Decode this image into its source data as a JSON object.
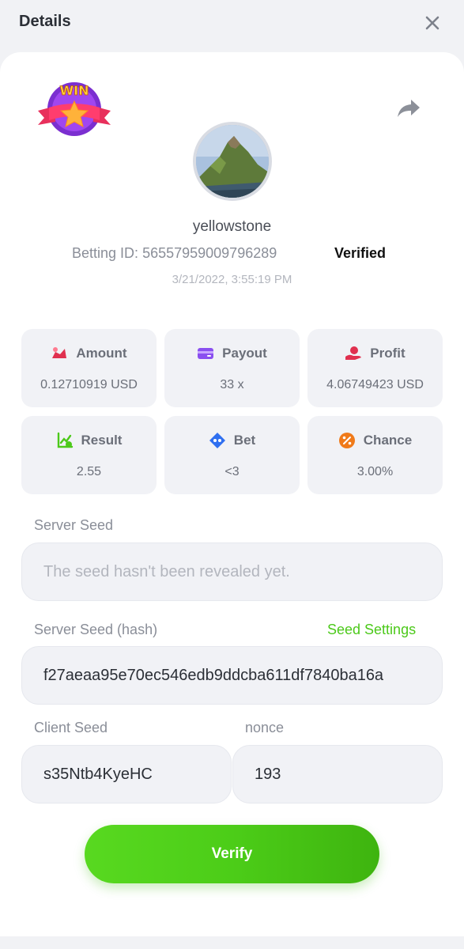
{
  "header": {
    "title": "Details"
  },
  "profile": {
    "username": "yellowstone",
    "betting_id_label": "Betting ID:",
    "betting_id": "56557959009796289",
    "verified_label": "Verified",
    "timestamp": "3/21/2022, 3:55:19 PM",
    "badge_text": "WIN"
  },
  "stats": [
    {
      "label": "Amount",
      "value": "0.12710919 USD",
      "icon": "amount-icon"
    },
    {
      "label": "Payout",
      "value": "33 x",
      "icon": "payout-icon"
    },
    {
      "label": "Profit",
      "value": "4.06749423 USD",
      "icon": "profit-icon"
    },
    {
      "label": "Result",
      "value": "2.55",
      "icon": "result-icon"
    },
    {
      "label": "Bet",
      "value": "<3",
      "icon": "bet-icon"
    },
    {
      "label": "Chance",
      "value": "3.00%",
      "icon": "chance-icon"
    }
  ],
  "server_seed": {
    "label": "Server Seed",
    "placeholder": "The seed hasn't been revealed yet."
  },
  "server_seed_hash": {
    "label": "Server Seed (hash)",
    "link": "Seed Settings",
    "value": "f27aeaa95e70ec546edb9ddcba611df7840ba16a"
  },
  "client_seed": {
    "label": "Client Seed",
    "value": "s35Ntb4KyeHC"
  },
  "nonce": {
    "label": "nonce",
    "value": "193"
  },
  "verify_button": {
    "label": "Verify"
  },
  "colors": {
    "accent_green": "#4cc91a",
    "amount_icon": "#e0304f",
    "payout_icon": "#8a4ff0",
    "profit_icon": "#e0304f",
    "result_icon": "#4cc91a",
    "bet_icon": "#2f6ff0",
    "chance_icon": "#f07a1a"
  }
}
